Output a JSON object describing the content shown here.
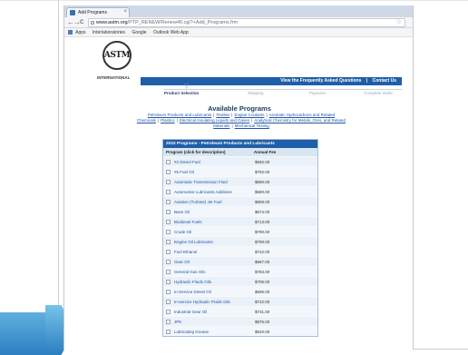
{
  "browser": {
    "tab_title": "Add Programs",
    "tab_close": "×",
    "nav": {
      "back": "←",
      "forward": "→",
      "reload": "C",
      "home": "⌂"
    },
    "url_host": "www.astm.org",
    "url_path": "/PTP_RENEW/Renew40.cgi?+Add_Programs.frm",
    "star": "☆",
    "bookmarks": [
      "Apps",
      "Interlaboratories",
      "Google",
      "Outlook Web App"
    ]
  },
  "header": {
    "logo_text": "ASTM",
    "logo_sub": "INTERNATIONAL",
    "link_faq": "View the Frequently Asked Questions",
    "link_sep": "|",
    "link_contact": "Contact Us"
  },
  "steps": [
    {
      "label": "Product Selection",
      "active": true
    },
    {
      "label": "Shipping",
      "active": false
    },
    {
      "label": "Payment",
      "active": false
    },
    {
      "label": "Complete Order",
      "active": false
    }
  ],
  "main": {
    "heading": "Available Programs",
    "categories": [
      "Petroleum Products and Lubricants",
      "Textiles",
      "Engine Coolants",
      "Aromatic Hydrocarbons and Related Chemicals",
      "Plastics",
      "Electrical Insulating Liquids and Gases",
      "Analytical Chemistry for Metals, Ores, and Related Materials",
      "Mechanical Testing"
    ],
    "category_sep": "|"
  },
  "table": {
    "title": "2022 Programs - Petroleum Products and Lubricants",
    "col_program": "Program (click for description)",
    "col_fee": "Annual Fee",
    "rows": [
      {
        "name": "#2 Diesel Fuel",
        "fee": "$692.00"
      },
      {
        "name": "#6 Fuel Oil",
        "fee": "$792.00"
      },
      {
        "name": "Automatic Transmission Fluid",
        "fee": "$690.00"
      },
      {
        "name": "Automotive Lubricants Additives",
        "fee": "$680.00"
      },
      {
        "name": "Aviation (Turbine) Jet Fuel",
        "fee": "$808.00"
      },
      {
        "name": "Base Oil",
        "fee": "$674.00"
      },
      {
        "name": "Biodiesel Fuels",
        "fee": "$713.00"
      },
      {
        "name": "Crude Oil",
        "fee": "$790.00"
      },
      {
        "name": "Engine Oil Lubricants",
        "fee": "$790.00"
      },
      {
        "name": "Fuel Ethanol",
        "fee": "$742.00"
      },
      {
        "name": "Gear Oil",
        "fee": "$667.00"
      },
      {
        "name": "General Gas Oils",
        "fee": "$783.00"
      },
      {
        "name": "Hydraulic Fluids Oils",
        "fee": "$705.00"
      },
      {
        "name": "In-Service Diesel Oil",
        "fee": "$695.00"
      },
      {
        "name": "In-service Hydraulic Fluids Oils",
        "fee": "$722.00"
      },
      {
        "name": "Industrial Gear Oil",
        "fee": "$731.00"
      },
      {
        "name": "JP8",
        "fee": "$876.00"
      },
      {
        "name": "Lubricating Grease",
        "fee": "$910.00"
      }
    ]
  }
}
